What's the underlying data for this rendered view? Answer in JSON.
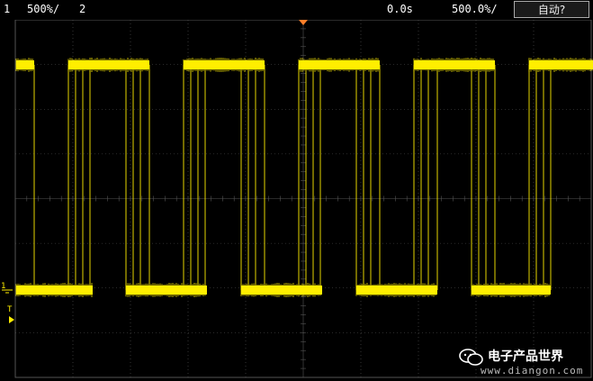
{
  "status_bar": {
    "channel1_number": "1",
    "channel1_scale": "500%/",
    "channel2_number": "2",
    "time_position": "0.0s",
    "time_scale": "500.0%/",
    "auto_button": "自动?"
  },
  "markers": {
    "channel1_ground": "1",
    "trigger_level": "T"
  },
  "colors": {
    "trace": "#ffee00",
    "grid": "#555555",
    "trigger_marker": "#ff7f2a"
  },
  "signal": {
    "high_level": "high",
    "low_level": "low",
    "high_segments": [
      [
        18,
        38
      ],
      [
        76,
        166
      ],
      [
        204,
        294
      ],
      [
        332,
        422
      ],
      [
        460,
        550
      ],
      [
        588,
        659
      ]
    ],
    "low_segments": [
      [
        18,
        103
      ],
      [
        140,
        230
      ],
      [
        268,
        358
      ],
      [
        396,
        486
      ],
      [
        524,
        612
      ]
    ],
    "edge_jitter_lines": [
      38,
      76,
      84,
      92,
      100,
      140,
      148,
      156,
      166,
      204,
      212,
      220,
      228,
      268,
      276,
      284,
      294,
      332,
      340,
      348,
      356,
      396,
      404,
      412,
      422,
      460,
      468,
      476,
      486,
      524,
      532,
      540,
      550,
      588,
      596,
      604,
      612
    ]
  },
  "watermark": {
    "title": "电子产品世界",
    "url": "www.diangon.com"
  }
}
